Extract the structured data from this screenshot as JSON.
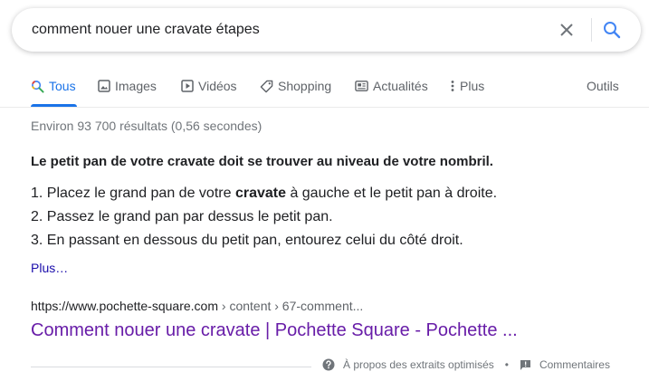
{
  "search": {
    "query": "comment nouer une cravate étapes",
    "clear_icon": "close-icon",
    "search_icon": "search-icon"
  },
  "tabs": [
    {
      "label": "Tous",
      "icon": "search-icon",
      "active": true
    },
    {
      "label": "Images",
      "icon": "image-icon"
    },
    {
      "label": "Vidéos",
      "icon": "play-icon"
    },
    {
      "label": "Shopping",
      "icon": "tag-icon"
    },
    {
      "label": "Actualités",
      "icon": "news-icon"
    },
    {
      "label": "Plus",
      "icon": "more-vert-icon"
    },
    {
      "label": "Outils"
    }
  ],
  "stats": "Environ 93 700 résultats (0,56 secondes)",
  "snippet": {
    "title": "Le petit pan de votre cravate doit se trouver au niveau de votre nombril.",
    "steps": [
      {
        "num": "1.",
        "before": "Placez le grand pan de votre",
        "bold": "cravate",
        "after": "à gauche et le petit pan à droite."
      },
      {
        "num": "2.",
        "text": "Passez le grand pan par dessus le petit pan."
      },
      {
        "num": "3.",
        "text": "En passant en dessous du petit pan, entourez celui du côté droit."
      }
    ],
    "more": "Plus…"
  },
  "result": {
    "url": "https://www.pochette-square.com",
    "breadcrumb": " › content › 67-comment...",
    "title": "Comment nouer une cravate | Pochette Square - Pochette ..."
  },
  "footer": {
    "about": "À propos des extraits optimisés",
    "separator": "•",
    "feedback": "Commentaires"
  },
  "colors": {
    "accent": "#1a73e8",
    "visited_link": "#681da8",
    "link": "#1a0dab",
    "muted": "#70757a"
  }
}
